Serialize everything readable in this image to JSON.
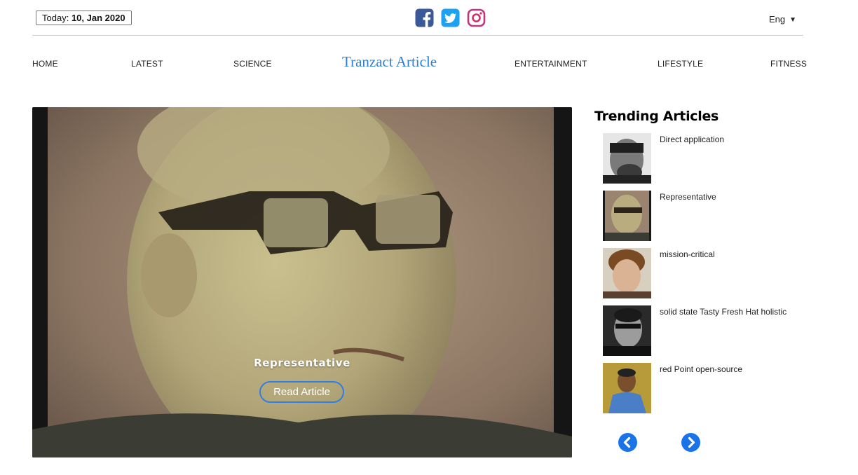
{
  "header": {
    "date_prefix": "Today:",
    "date_value": "10, Jan 2020",
    "language": "Eng",
    "socials": [
      {
        "icon": "facebook-icon",
        "color": "#3b5998"
      },
      {
        "icon": "twitter-icon",
        "color": "#1da1f2"
      },
      {
        "icon": "instagram-icon",
        "color": "#c13584"
      }
    ]
  },
  "nav": {
    "brand": "Tranzact Article",
    "items": [
      "HOME",
      "LATEST",
      "SCIENCE",
      "ENTERTAINMENT",
      "LIFESTYLE",
      "FITNESS"
    ]
  },
  "hero": {
    "title": "Representative",
    "button": "Read Article"
  },
  "trending": {
    "heading": "Trending Articles",
    "items": [
      {
        "label": "Direct application"
      },
      {
        "label": "Representative"
      },
      {
        "label": "mission-critical"
      },
      {
        "label": "solid state Tasty Fresh Hat holistic"
      },
      {
        "label": "red Point open-source"
      }
    ]
  },
  "colors": {
    "brand": "#2b7fd6",
    "accent": "#1a73e8",
    "date_border": "#1a9bb0"
  }
}
